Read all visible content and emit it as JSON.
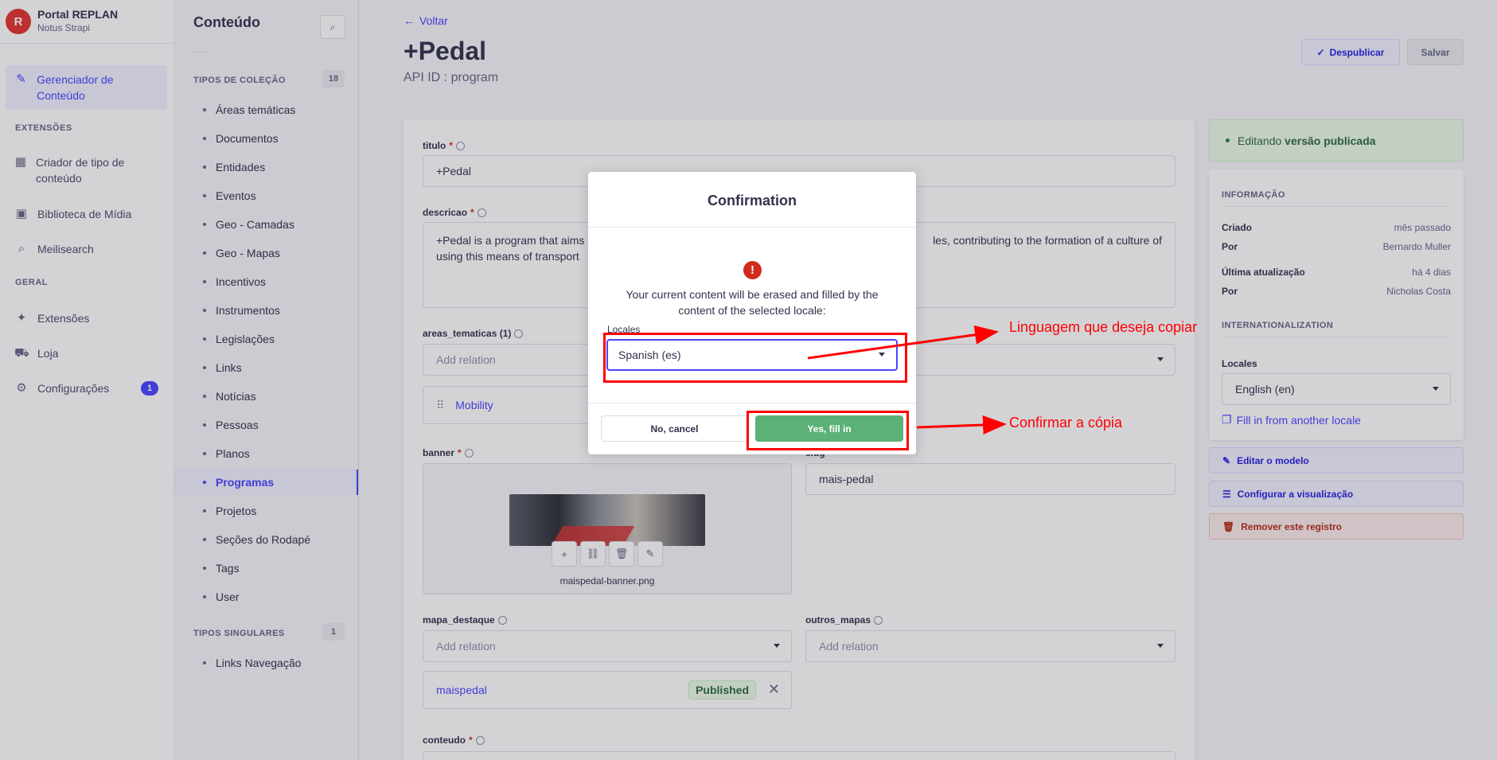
{
  "brand": {
    "initial": "R",
    "title": "Portal REPLAN",
    "subtitle": "Notus Strapi"
  },
  "mainnav": {
    "content_manager": "Gerenciador de Conteúdo",
    "section_extensions": "EXTENSÕES",
    "type_builder": "Criador de tipo de conteúdo",
    "media_library": "Biblioteca de Mídia",
    "meilisearch": "Meilisearch",
    "section_general": "GERAL",
    "plugins": "Extensões",
    "marketplace": "Loja",
    "settings": "Configurações",
    "settings_badge": "1"
  },
  "subnav": {
    "title": "Conteúdo",
    "collection_section": "TIPOS DE COLEÇÃO",
    "collection_count": "18",
    "collection_items": [
      "Áreas temáticas",
      "Documentos",
      "Entidades",
      "Eventos",
      "Geo - Camadas",
      "Geo - Mapas",
      "Incentivos",
      "Instrumentos",
      "Legislações",
      "Links",
      "Notícias",
      "Pessoas",
      "Planos",
      "Programas",
      "Projetos",
      "Seções do Rodapé",
      "Tags",
      "User"
    ],
    "active_item": "Programas",
    "single_section": "TIPOS SINGULARES",
    "single_count": "1",
    "single_items": [
      "Links Navegação"
    ]
  },
  "header": {
    "back": "Voltar",
    "title": "+Pedal",
    "api_id": "API ID : program",
    "unpublish": "Despublicar",
    "save": "Salvar"
  },
  "form": {
    "titulo_label": "titulo",
    "titulo_value": "+Pedal",
    "descricao_label": "descricao",
    "descricao_left": "+Pedal is a program that aims",
    "descricao_right": "les, contributing to the formation of a culture of",
    "descricao_line2": "using this means of transport",
    "areas_label": "areas_tematicas (1)",
    "add_relation": "Add relation",
    "areas_item": "Mobility",
    "banner_label": "banner",
    "banner_file": "maispedal-banner.png",
    "slug_label": "slug",
    "slug_value": "mais-pedal",
    "mapa_label": "mapa_destaque",
    "outros_label": "outros_mapas",
    "mapa_item": "maispedal",
    "mapa_status": "Published",
    "conteudo_label": "conteudo"
  },
  "side": {
    "editing_prefix": "Editando",
    "editing_bold": "versão publicada",
    "info_header": "INFORMAÇÃO",
    "created_k": "Criado",
    "created_v": "mês passado",
    "by1_k": "Por",
    "by1_v": "Bernardo Muller",
    "updated_k": "Última atualização",
    "updated_v": "há 4 dias",
    "by2_k": "Por",
    "by2_v": "Nicholas Costa",
    "i18n_header": "INTERNATIONALIZATION",
    "locales_label": "Locales",
    "locale_value": "English (en)",
    "fill_link": "Fill in from another locale",
    "edit_model": "Editar o modelo",
    "configure_view": "Configurar a visualização",
    "delete": "Remover este registro"
  },
  "modal": {
    "title": "Confirmation",
    "message": "Your current content will be erased and filled by the content of the selected locale:",
    "locales_label": "Locales",
    "selected_locale": "Spanish (es)",
    "cancel": "No, cancel",
    "confirm": "Yes, fill in"
  },
  "annotations": {
    "language": "Linguagem que deseja copiar",
    "confirm": "Confirmar a cópia",
    "color": "#ff0000"
  }
}
